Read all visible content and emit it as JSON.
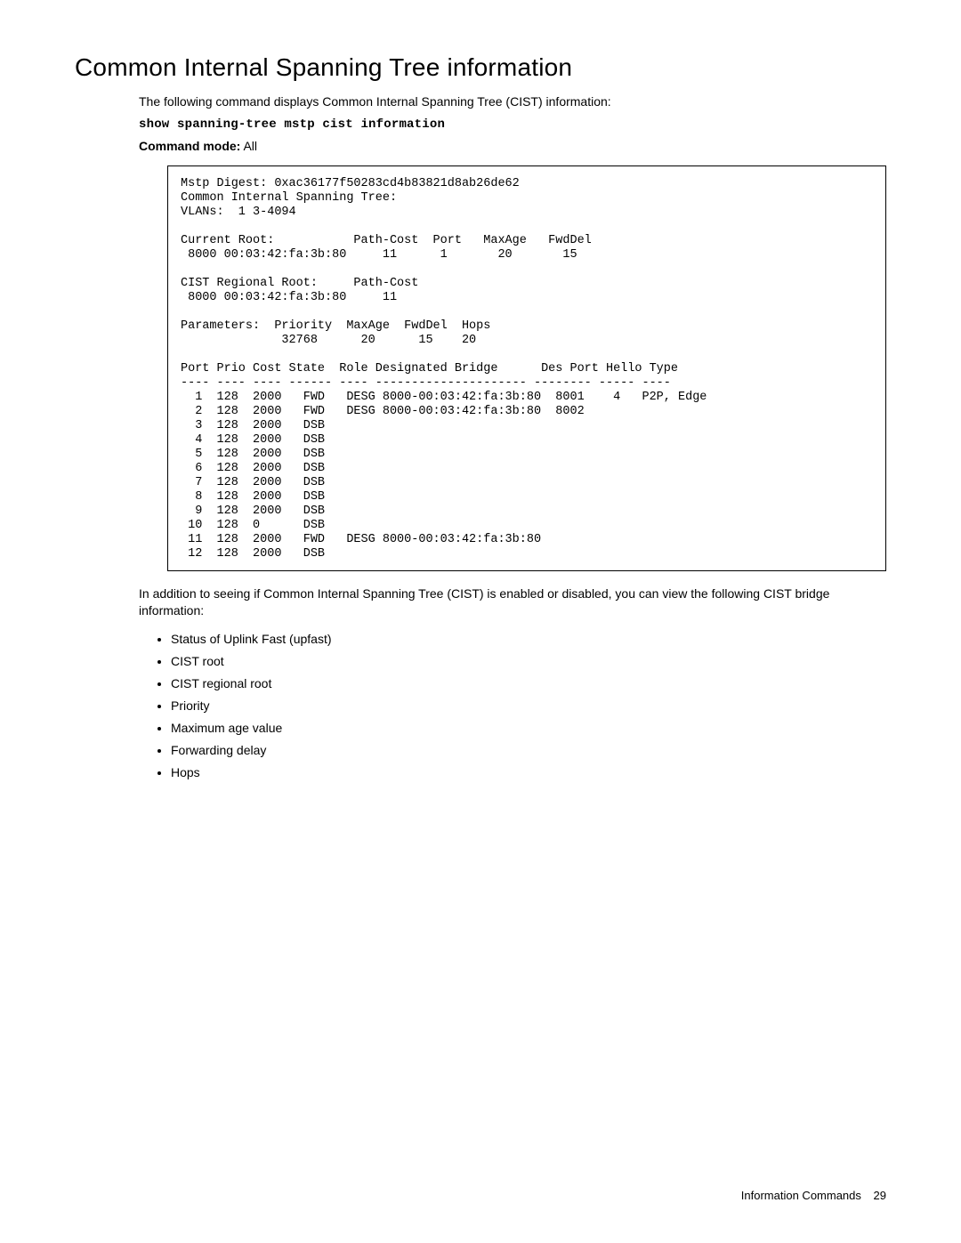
{
  "title": "Common Internal Spanning Tree information",
  "intro": "The following command displays Common Internal Spanning Tree (CIST) information:",
  "command": "show spanning-tree mstp cist information",
  "mode_label": "Command mode:",
  "mode_value": " All",
  "after_text": "In addition to seeing if Common Internal Spanning Tree (CIST) is enabled or disabled, you can view the following CIST bridge information:",
  "list_items": [
    "Status of Uplink Fast (upfast)",
    "CIST root",
    "CIST regional root",
    "Priority",
    "Maximum age value",
    "Forwarding delay",
    "Hops"
  ],
  "footer_section": "Information Commands",
  "footer_page": "29",
  "output": {
    "digest_line": "Mstp Digest: 0xac36177f50283cd4b83821d8ab26de62",
    "cist_line": "Common Internal Spanning Tree:",
    "vlans_line": "VLANs:  1 3-4094",
    "curr_root_hdr": "Current Root:           Path-Cost  Port   MaxAge   FwdDel",
    "curr_root_val": " 8000 00:03:42:fa:3b:80     11      1       20       15",
    "reg_root_hdr": "CIST Regional Root:     Path-Cost",
    "reg_root_val": " 8000 00:03:42:fa:3b:80     11",
    "param_hdr": "Parameters:  Priority  MaxAge  FwdDel  Hops",
    "param_val": "              32768      20      15    20",
    "table_hdr": "Port Prio Cost State  Role Designated Bridge      Des Port Hello Type",
    "table_sep": "---- ---- ---- ------ ---- --------------------- -------- ----- ----",
    "rows": [
      "  1  128  2000   FWD   DESG 8000-00:03:42:fa:3b:80  8001    4   P2P, Edge",
      "  2  128  2000   FWD   DESG 8000-00:03:42:fa:3b:80  8002",
      "  3  128  2000   DSB",
      "  4  128  2000   DSB",
      "  5  128  2000   DSB",
      "  6  128  2000   DSB",
      "  7  128  2000   DSB",
      "  8  128  2000   DSB",
      "  9  128  2000   DSB",
      " 10  128  0      DSB",
      " 11  128  2000   FWD   DESG 8000-00:03:42:fa:3b:80",
      " 12  128  2000   DSB"
    ]
  },
  "chart_data": {
    "type": "table",
    "title": "CIST Port Table",
    "columns": [
      "Port",
      "Prio",
      "Cost",
      "State",
      "Role",
      "Designated Bridge",
      "Des Port",
      "Hello",
      "Type"
    ],
    "rows": [
      [
        1,
        128,
        2000,
        "FWD",
        "DESG",
        "8000-00:03:42:fa:3b:80",
        "8001",
        4,
        "P2P, Edge"
      ],
      [
        2,
        128,
        2000,
        "FWD",
        "DESG",
        "8000-00:03:42:fa:3b:80",
        "8002",
        null,
        null
      ],
      [
        3,
        128,
        2000,
        "DSB",
        null,
        null,
        null,
        null,
        null
      ],
      [
        4,
        128,
        2000,
        "DSB",
        null,
        null,
        null,
        null,
        null
      ],
      [
        5,
        128,
        2000,
        "DSB",
        null,
        null,
        null,
        null,
        null
      ],
      [
        6,
        128,
        2000,
        "DSB",
        null,
        null,
        null,
        null,
        null
      ],
      [
        7,
        128,
        2000,
        "DSB",
        null,
        null,
        null,
        null,
        null
      ],
      [
        8,
        128,
        2000,
        "DSB",
        null,
        null,
        null,
        null,
        null
      ],
      [
        9,
        128,
        2000,
        "DSB",
        null,
        null,
        null,
        null,
        null
      ],
      [
        10,
        128,
        0,
        "DSB",
        null,
        null,
        null,
        null,
        null
      ],
      [
        11,
        128,
        2000,
        "FWD",
        "DESG",
        "8000-00:03:42:fa:3b:80",
        null,
        null,
        null
      ],
      [
        12,
        128,
        2000,
        "DSB",
        null,
        null,
        null,
        null,
        null
      ]
    ],
    "mstp_digest": "0xac36177f50283cd4b83821d8ab26de62",
    "vlans": "1 3-4094",
    "current_root": {
      "bridge": "8000 00:03:42:fa:3b:80",
      "path_cost": 11,
      "port": 1,
      "max_age": 20,
      "fwd_del": 15
    },
    "cist_regional_root": {
      "bridge": "8000 00:03:42:fa:3b:80",
      "path_cost": 11
    },
    "parameters": {
      "priority": 32768,
      "max_age": 20,
      "fwd_del": 15,
      "hops": 20
    }
  }
}
